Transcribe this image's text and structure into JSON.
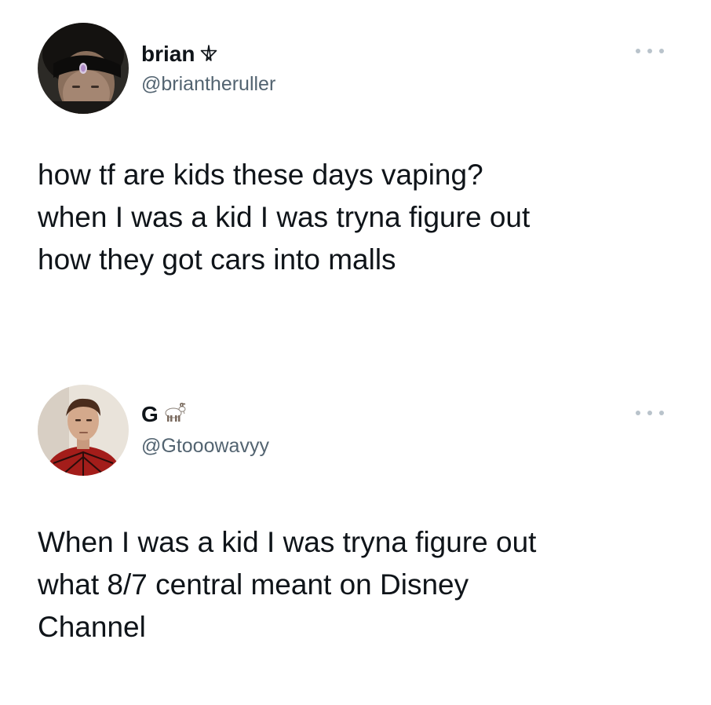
{
  "tweets": [
    {
      "display_name": "brian",
      "name_emoji": "pentagram-icon",
      "handle": "@briantheruller",
      "text_lines": [
        "how tf are kids these days vaping?",
        "when I was a kid I was tryna figure out",
        "how they got cars into malls"
      ]
    },
    {
      "display_name": "G",
      "name_emoji": "goat-icon",
      "handle": "@Gtooowavyy",
      "text_lines": [
        "When I was a kid I was tryna figure out",
        "what 8/7 central meant on Disney",
        "Channel"
      ]
    }
  ],
  "colors": {
    "text": "#0f1419",
    "secondary_text": "#536471",
    "more_dots": "#b9c3cb",
    "background": "#ffffff"
  }
}
